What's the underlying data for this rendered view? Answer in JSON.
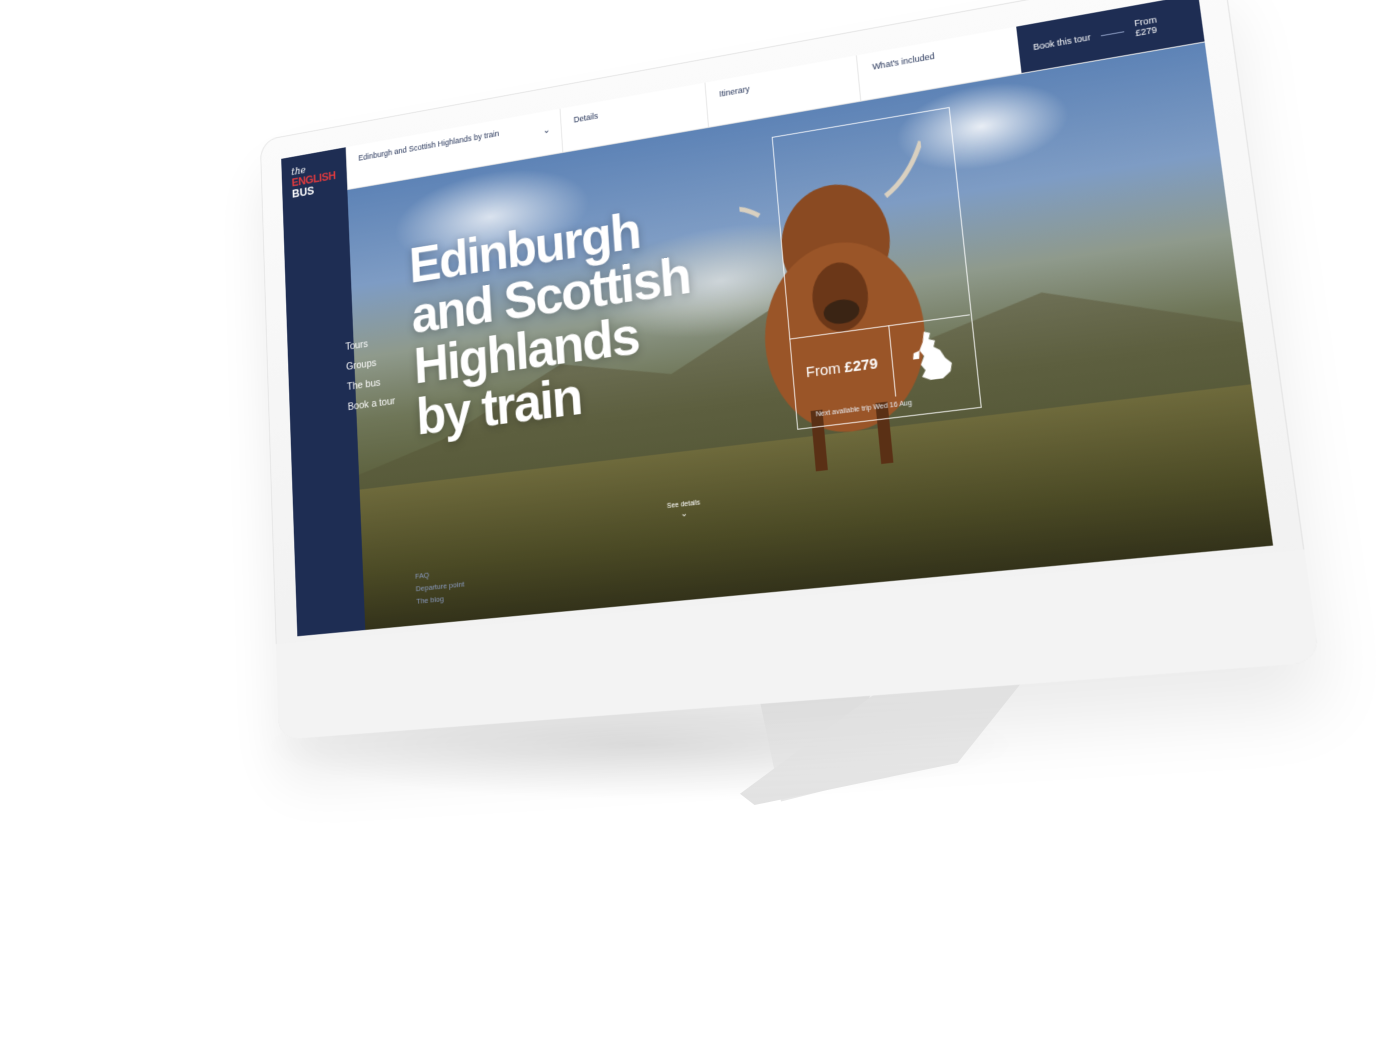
{
  "brand": {
    "the": "the",
    "english": "ENGLISH",
    "bus": "BUS"
  },
  "topbar": {
    "tour_title": "Edinburgh and Scottish Highlands by train",
    "tabs": [
      "Details",
      "Itinerary",
      "What's included"
    ],
    "book_label": "Book this tour",
    "from_label": "From",
    "from_price": "£279"
  },
  "sidebar": {
    "nav": [
      "Tours",
      "Groups",
      "The bus",
      "Book a tour"
    ],
    "footer": [
      "FAQ",
      "Departure point",
      "The blog"
    ]
  },
  "hero": {
    "headline": [
      "Edinburgh",
      "and Scottish",
      "Highlands",
      "by train"
    ],
    "price_from": "From",
    "price_value": "£279",
    "next_date": "Next available trip Wed 16 Aug",
    "see_details": "See details"
  },
  "colors": {
    "navy": "#1e2d53",
    "brand_red": "#e03a3e"
  },
  "icons": [
    "chevron-down-icon",
    "uk-map-icon"
  ]
}
